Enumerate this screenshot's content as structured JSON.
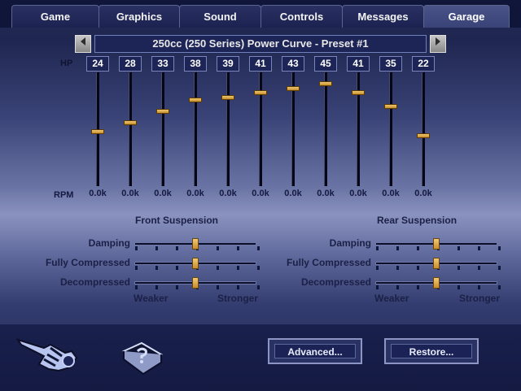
{
  "tabs": [
    "Game",
    "Graphics",
    "Sound",
    "Controls",
    "Messages",
    "Garage"
  ],
  "active_tab": "Garage",
  "curve": {
    "title": "250cc (250 Series) Power Curve - Preset #1",
    "prev_icon": "left-arrow-icon",
    "next_icon": "right-arrow-icon"
  },
  "hp_label": "HP",
  "rpm_label": "RPM",
  "hp_values": [
    "24",
    "28",
    "33",
    "38",
    "39",
    "41",
    "43",
    "45",
    "41",
    "35",
    "22"
  ],
  "rpm_values": [
    "0.0k",
    "0.0k",
    "0.0k",
    "0.0k",
    "0.0k",
    "0.0k",
    "0.0k",
    "0.0k",
    "0.0k",
    "0.0k",
    "0.0k"
  ],
  "suspension": {
    "front": {
      "title": "Front Suspension",
      "rows": [
        {
          "label": "Damping",
          "level": 0.5
        },
        {
          "label": "Fully Compressed",
          "level": 0.5
        },
        {
          "label": "Decompressed",
          "level": 0.5
        }
      ],
      "weaker": "Weaker",
      "stronger": "Stronger"
    },
    "rear": {
      "title": "Rear Suspension",
      "rows": [
        {
          "label": "Damping",
          "level": 0.5
        },
        {
          "label": "Fully Compressed",
          "level": 0.5
        },
        {
          "label": "Decompressed",
          "level": 0.5
        }
      ],
      "weaker": "Weaker",
      "stronger": "Stronger"
    }
  },
  "buttons": {
    "advanced": "Advanced...",
    "restore": "Restore..."
  },
  "icons": {
    "back": "pointing-hand-icon",
    "help": "manual-book-icon"
  },
  "colors": {
    "accent": "#d7a13a",
    "panel": "#1d2456"
  }
}
